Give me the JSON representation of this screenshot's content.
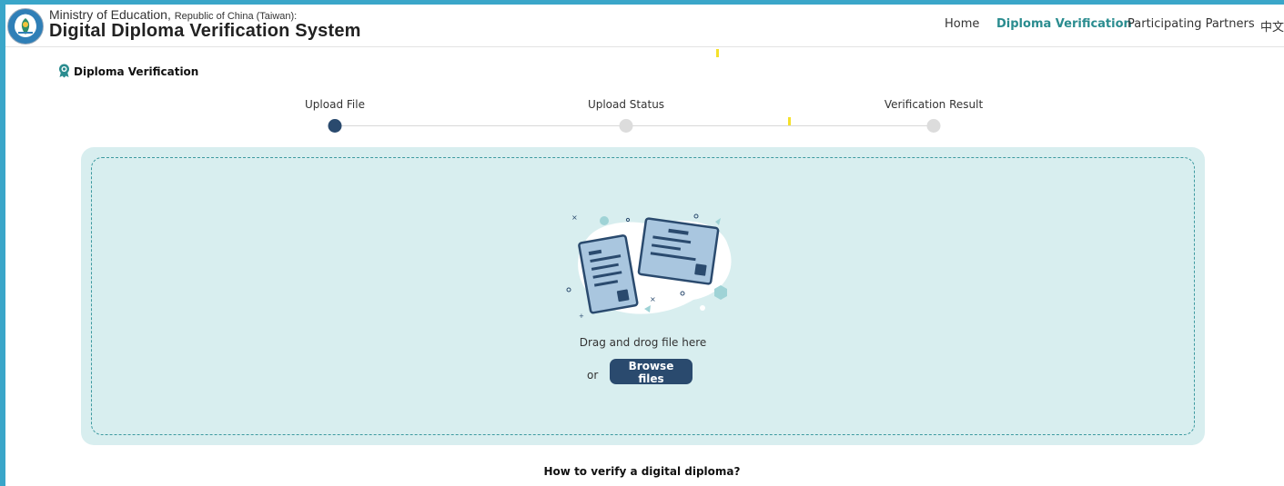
{
  "header": {
    "title_line1_main": "Ministry of Education,",
    "title_line1_small": "Republic of China (Taiwan):",
    "title_line2": "Digital Diploma Verification System"
  },
  "nav": {
    "items": [
      {
        "label": "Home",
        "active": false
      },
      {
        "label": "Diploma Verification",
        "active": true
      },
      {
        "label": "Participating Partners",
        "active": false
      },
      {
        "label": "中文",
        "active": false
      }
    ]
  },
  "page": {
    "section_title": "Diploma Verification",
    "section_icon": "award-ribbon-icon"
  },
  "stepper": {
    "steps": [
      {
        "label": "Upload File",
        "state": "current"
      },
      {
        "label": "Upload Status",
        "state": "pending"
      },
      {
        "label": "Verification Result",
        "state": "pending"
      }
    ]
  },
  "upload": {
    "drag_text": "Drag and drog file here",
    "or_text": "or",
    "browse_label": "Browse files",
    "illustration": "documents-illustration"
  },
  "footer": {
    "howto_title": "How to verify a digital diploma?"
  },
  "colors": {
    "accent_teal": "#2a8c8f",
    "primary_navy": "#2a4a6e",
    "dropzone_bg": "#d8eeef",
    "dropzone_border": "#3d9aa0",
    "frame_blue": "#3aa6c9"
  }
}
